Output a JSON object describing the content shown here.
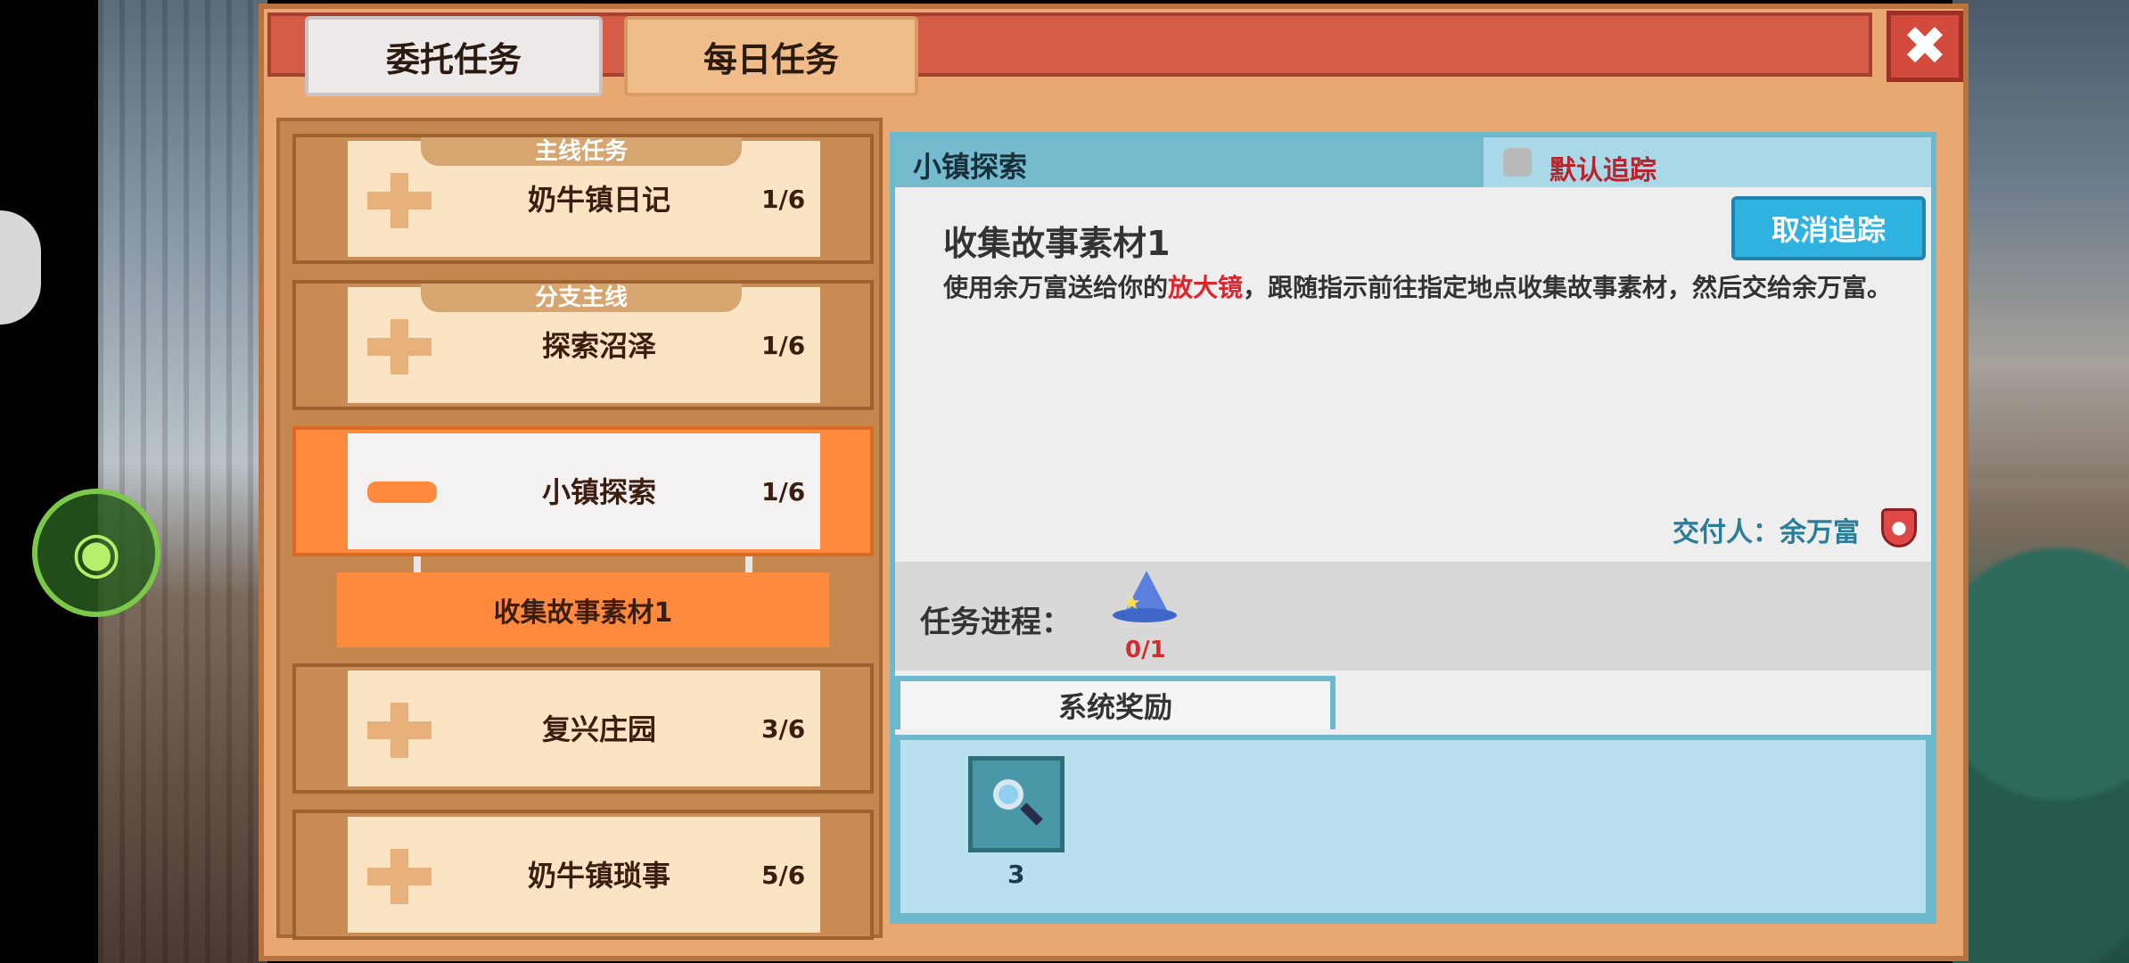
{
  "tabs": {
    "commission": "委托任务",
    "daily": "每日任务"
  },
  "close_icon": "close-icon",
  "quest_list": [
    {
      "category": "主线任务",
      "title": "奶牛镇日记",
      "progress": "1/6"
    },
    {
      "category": "分支主线",
      "title": "探索沼泽",
      "progress": "1/6"
    },
    {
      "title": "小镇探索",
      "progress": "1/6",
      "expanded": true,
      "subtask": "收集故事素材1"
    },
    {
      "title": "复兴庄园",
      "progress": "3/6"
    },
    {
      "title": "奶牛镇琐事",
      "progress": "5/6"
    }
  ],
  "detail": {
    "quest_name": "小镇探索",
    "default_track_label": "默认追踪",
    "untrack_button": "取消追踪",
    "task_title": "收集故事素材1",
    "description_parts": {
      "before": "使用余万富送给你的",
      "highlight": "放大镜",
      "after": "，跟随指示前往指定地点收集故事素材，然后交给余万富。"
    },
    "submitter": "交付人：余万富",
    "progress_label": "任务进程：",
    "progress_count": "0/1",
    "reward_tab": "系统奖励",
    "reward_count": "3"
  },
  "colors": {
    "panel": "#e9a871",
    "topbar": "#d45b45",
    "active_card": "#ff8a3d",
    "detail_header": "#75bacd",
    "highlight_text": "#e0242c",
    "untrack_button": "#2fb2df"
  }
}
